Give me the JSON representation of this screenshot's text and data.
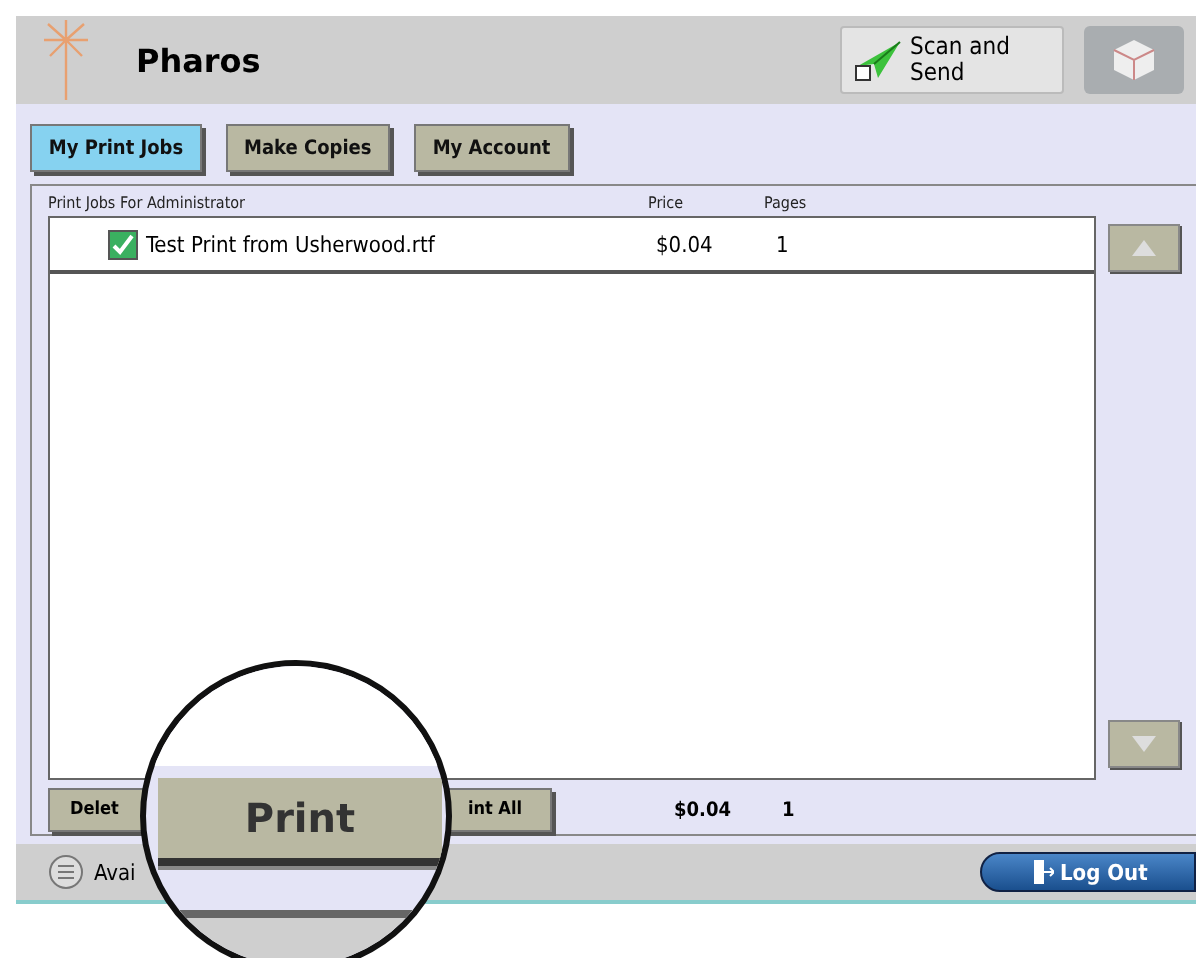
{
  "header": {
    "title": "Pharos",
    "scan_button": "Scan and Send"
  },
  "tabs": [
    {
      "label": "My Print Jobs",
      "selected": true
    },
    {
      "label": "Make Copies",
      "selected": false
    },
    {
      "label": "My Account",
      "selected": false
    }
  ],
  "list": {
    "heading": "Print Jobs For Administrator",
    "columns": [
      "Price",
      "Pages"
    ],
    "rows": [
      {
        "checked": true,
        "name": "Test Print from Usherwood.rtf",
        "price": "$0.04",
        "pages": "1"
      }
    ]
  },
  "footer": {
    "buttons": [
      "Delet",
      "int All"
    ],
    "total_price": "$0.04",
    "total_pages": "1"
  },
  "status": {
    "text": "Avai",
    "logout": "Log Out"
  },
  "magnifier": {
    "button": "Print"
  }
}
